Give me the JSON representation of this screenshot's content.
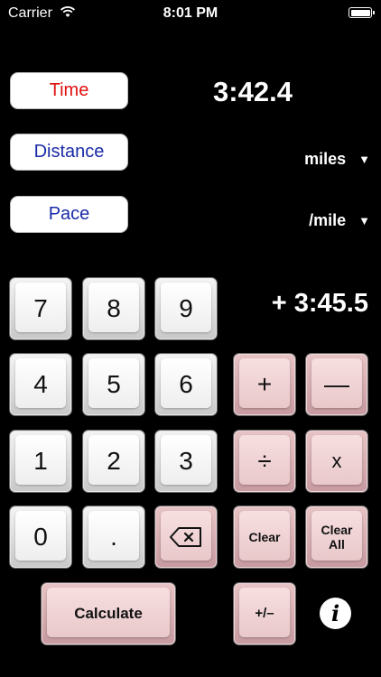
{
  "status_bar": {
    "carrier": "Carrier",
    "time": "8:01 PM"
  },
  "modes": {
    "time_label": "Time",
    "distance_label": "Distance",
    "pace_label": "Pace"
  },
  "display": {
    "time_value": "3:42.4",
    "pending_operation": "+ 3:45.5"
  },
  "units": {
    "distance": "miles",
    "pace": "/mile",
    "caret": "▼"
  },
  "keypad": {
    "digits": {
      "7": "7",
      "8": "8",
      "9": "9",
      "4": "4",
      "5": "5",
      "6": "6",
      "1": "1",
      "2": "2",
      "3": "3",
      "0": "0"
    },
    "decimal": ".",
    "plus": "+",
    "minus": "—",
    "divide": "÷",
    "multiply": "x",
    "clear": "Clear",
    "clear_all_line1": "Clear",
    "clear_all_line2": "All",
    "calculate": "Calculate",
    "plus_minus": "+/–",
    "info": "i"
  },
  "colors": {
    "time_label": "#e01010",
    "mode_label": "#1a2aa8",
    "operator_key": "#e9c8ca",
    "digit_key": "#eeeeee"
  }
}
